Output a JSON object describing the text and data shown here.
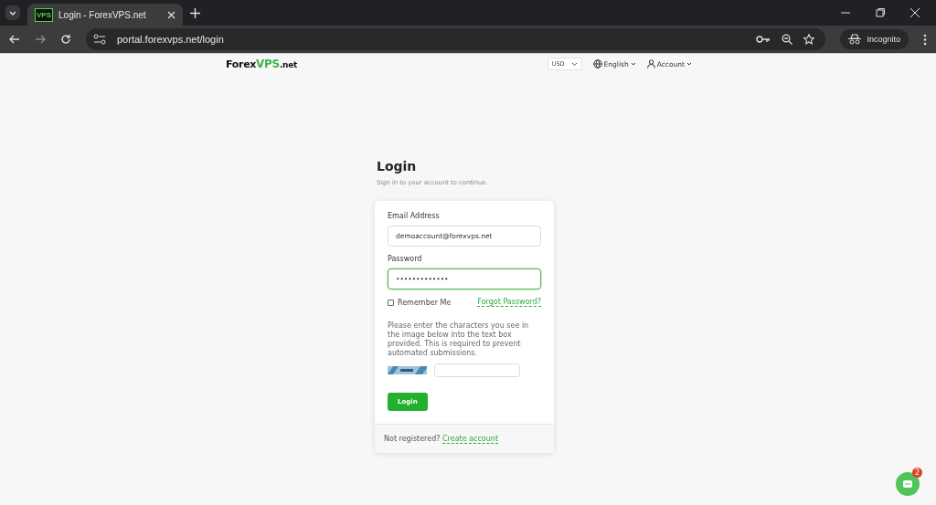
{
  "browser": {
    "tab_title": "Login - ForexVPS.net",
    "tab_icon": "VPS",
    "url": "portal.forexvps.net/login",
    "profile": "Incognito"
  },
  "header": {
    "logo": {
      "prefix": "Forex",
      "brand": "VPS",
      "suffix": ".net"
    },
    "currency": "USD",
    "language": "English",
    "account": "Account"
  },
  "login": {
    "title": "Login",
    "subtitle": "Sign in to your account to continue.",
    "email": {
      "label": "Email Address",
      "value": "demoaccount@forexvps.net",
      "focused": false
    },
    "password": {
      "label": "Password",
      "value": "•••••••••••••",
      "focused": true
    },
    "remember": {
      "label": "Remember Me",
      "checked": false
    },
    "forgot": "Forgot Password?",
    "captcha_note": "Please enter the characters you see in the image below into the text box provided. This is required to prevent automated submissions.",
    "submit": "Login",
    "footer": {
      "text": "Not registered?",
      "link": "Create account"
    }
  },
  "chat": {
    "badge": "2"
  }
}
